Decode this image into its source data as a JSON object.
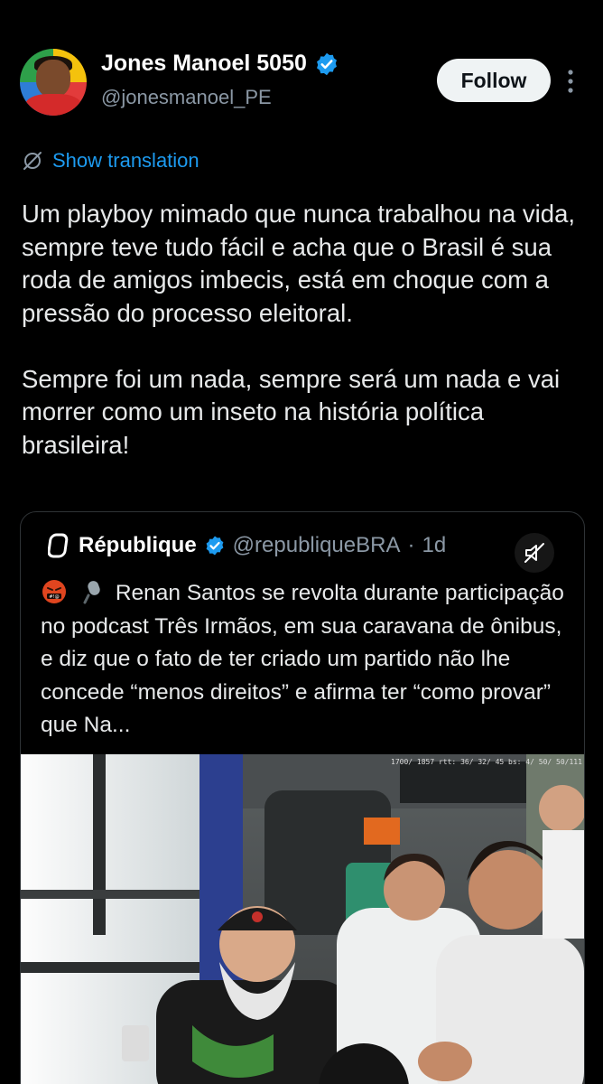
{
  "author": {
    "display_name": "Jones Manoel 5050",
    "handle": "@jonesmanoel_PE",
    "verified_icon": "verified-badge-icon"
  },
  "actions": {
    "follow_label": "Follow",
    "more_icon": "more-vertical-icon"
  },
  "translation": {
    "label": "Show translation",
    "icon": "translate-slash-icon"
  },
  "tweet": {
    "text": "Um playboy mimado que nunca trabalhou na vida, sempre teve tudo fácil e acha que o Brasil é sua roda de amigos imbecis, está em choque com a pressão do processo eleitoral.\n\nSempre foi um nada, sempre será um nada e vai morrer como um inseto na história política brasileira!"
  },
  "quote": {
    "name": "République",
    "handle": "@republiqueBRA",
    "separator": "·",
    "time": "1d",
    "emojis": [
      "angry-swearing-face-emoji",
      "microphone-emoji"
    ],
    "text": "Renan Santos se revolta durante participação no podcast Três Irmãos, em sua caravana de ônibus, e diz que o fato de ter criado um partido não lhe concede “menos direitos” e afirma ter “como provar” que Na...",
    "media": {
      "overlay_text": "1700/ 1857 rtt:  36/ 32/ 45 bs:   4/ 50/ 50/111",
      "mute_icon": "sound-off-icon"
    }
  },
  "colors": {
    "background": "#000000",
    "text": "#e7e9ea",
    "secondary": "#8b98a5",
    "link": "#1d9bf0",
    "verified": "#1d9bf0",
    "follow_bg": "#eff3f4",
    "border": "#2f3336"
  }
}
